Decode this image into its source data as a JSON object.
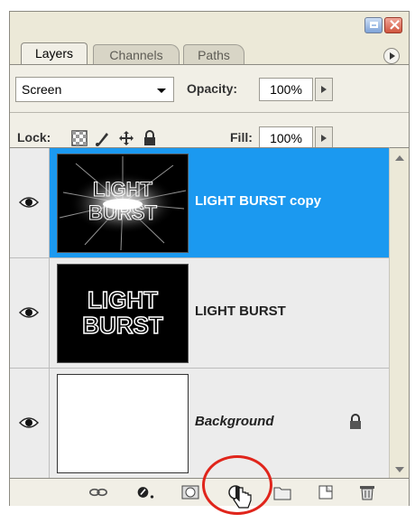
{
  "panel": {
    "tabs": [
      {
        "label": "Layers",
        "active": true
      },
      {
        "label": "Channels",
        "active": false
      },
      {
        "label": "Paths",
        "active": false
      }
    ]
  },
  "options": {
    "blend_mode": "Screen",
    "opacity_label": "Opacity:",
    "opacity_value": "100%",
    "lock_label": "Lock:",
    "fill_label": "Fill:",
    "fill_value": "100%",
    "lock_icons": [
      "lock-transparent-icon",
      "lock-image-icon",
      "lock-position-icon",
      "lock-all-icon"
    ]
  },
  "layers": [
    {
      "name": "LIGHT BURST copy",
      "visible": true,
      "selected": true,
      "thumb_text": [
        "LIGHT",
        "BURST"
      ],
      "thumb_type": "burst"
    },
    {
      "name": "LIGHT BURST",
      "visible": true,
      "selected": false,
      "thumb_text": [
        "LIGHT",
        "BURST"
      ],
      "thumb_type": "text"
    },
    {
      "name": "Background",
      "visible": true,
      "selected": false,
      "locked": true,
      "thumb_type": "white"
    }
  ],
  "bottom_icons": [
    "link-layers-icon",
    "layer-style-icon",
    "layer-mask-icon",
    "adjustment-layer-icon",
    "new-group-icon",
    "new-layer-icon",
    "trash-icon"
  ],
  "colors": {
    "selected": "#1b99f0",
    "highlight_circle": "#e0251b"
  }
}
